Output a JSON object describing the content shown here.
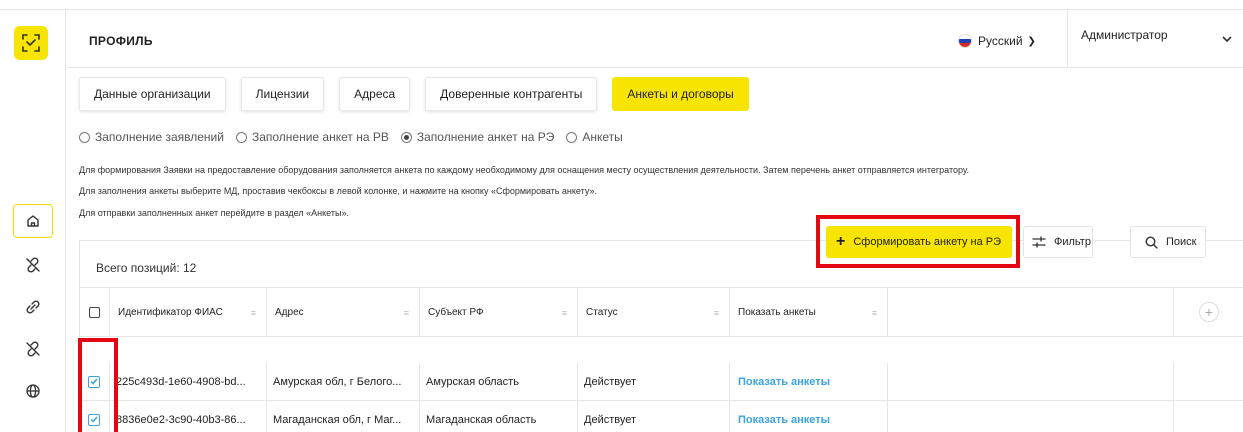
{
  "header": {
    "title": "ПРОФИЛЬ",
    "language": "Русский",
    "user": "Администратор"
  },
  "sidebar": {
    "icons": [
      "logo-icon",
      "home-icon",
      "link-off-icon",
      "link-icon",
      "link-off-icon",
      "globe-icon"
    ]
  },
  "tabs": [
    {
      "label": "Данные организации",
      "active": false
    },
    {
      "label": "Лицензии",
      "active": false
    },
    {
      "label": "Адреса",
      "active": false
    },
    {
      "label": "Доверенные контрагенты",
      "active": false
    },
    {
      "label": "Анкеты и договоры",
      "active": true
    }
  ],
  "radios": [
    {
      "label": "Заполнение заявлений",
      "checked": false
    },
    {
      "label": "Заполнение анкет на РВ",
      "checked": false
    },
    {
      "label": "Заполнение анкет на РЭ",
      "checked": true
    },
    {
      "label": "Анкеты",
      "checked": false
    }
  ],
  "info": [
    "Для формирования Заявки на предоставление оборудования заполняется анкета по каждому необходимому для оснащения месту осуществления деятельности. Затем перечень анкет отправляется интегратору.",
    "Для заполнения анкеты выберите МД, проставив чекбоксы в левой колонке, и нажмите на кнопку «Сформировать анкету».",
    "Для отправки заполненных анкет перейдите в раздел «Анкеты»."
  ],
  "actions": {
    "create": "Сформировать анкету на РЭ",
    "filter": "Фильтр",
    "search": "Поиск"
  },
  "table": {
    "total": "Всего позиций: 12",
    "columns": [
      "Идентификатор ФИАС",
      "Адрес",
      "Субъект РФ",
      "Статус",
      "Показать анкеты"
    ],
    "rows": [
      {
        "fias": "225c493d-1e60-4908-bd...",
        "address": "Амурская обл, г Белого...",
        "subject": "Амурская область",
        "status": "Действует",
        "show": "Показать анкеты"
      },
      {
        "fias": "8836e0e2-3c90-40b3-86...",
        "address": "Магаданская обл, г Маг...",
        "subject": "Магаданская область",
        "status": "Действует",
        "show": "Показать анкеты"
      }
    ]
  },
  "colors": {
    "accent": "#f7e400",
    "highlight": "#e30613",
    "link": "#3aa3e3"
  }
}
